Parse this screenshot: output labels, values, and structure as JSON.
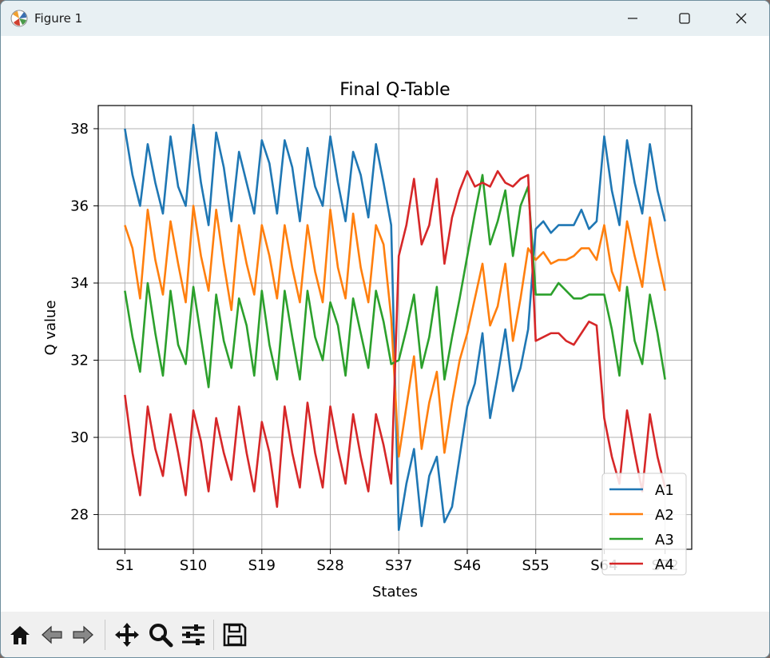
{
  "window": {
    "title": "Figure 1",
    "controls": {
      "minimize": "minimize-icon",
      "maximize": "maximize-icon",
      "close": "close-icon"
    }
  },
  "toolbar": {
    "buttons": [
      "home-icon",
      "back-icon",
      "forward-icon",
      "pan-icon",
      "zoom-icon",
      "configure-subplots-icon",
      "save-icon"
    ]
  },
  "chart_data": {
    "type": "line",
    "title": "Final Q-Table",
    "xlabel": "States",
    "ylabel": "Q value",
    "x_tick_labels": [
      "S1",
      "S10",
      "S19",
      "S28",
      "S37",
      "S46",
      "S55",
      "S64",
      "S72"
    ],
    "x_tick_positions": [
      1,
      10,
      19,
      28,
      37,
      46,
      55,
      64,
      72
    ],
    "y_ticks": [
      28,
      30,
      32,
      34,
      36,
      38
    ],
    "xlim": [
      -2.5,
      75.5
    ],
    "ylim": [
      27.1,
      38.6
    ],
    "grid": true,
    "legend": "lower-right",
    "colors": {
      "A1": "#1f77b4",
      "A2": "#ff7f0e",
      "A3": "#2ca02c",
      "A4": "#d62728"
    },
    "series": [
      {
        "name": "A1",
        "values": [
          38.0,
          36.8,
          36.0,
          37.6,
          36.6,
          35.8,
          37.8,
          36.5,
          36.0,
          38.1,
          36.6,
          35.5,
          37.9,
          37.0,
          35.6,
          37.4,
          36.6,
          35.8,
          37.7,
          37.1,
          35.8,
          37.7,
          37.0,
          35.6,
          37.5,
          36.5,
          36.0,
          37.8,
          36.6,
          35.6,
          37.4,
          36.8,
          35.7,
          37.6,
          36.6,
          35.5,
          27.6,
          28.8,
          29.7,
          27.7,
          29.0,
          29.5,
          27.8,
          28.2,
          29.5,
          30.8,
          31.4,
          32.7,
          30.5,
          31.6,
          32.8,
          31.2,
          31.8,
          32.8,
          35.4,
          35.6,
          35.3,
          35.5,
          35.5,
          35.5,
          35.9,
          35.4,
          35.6,
          37.8,
          36.4,
          35.5,
          37.7,
          36.6,
          35.8,
          37.6,
          36.4,
          35.6
        ]
      },
      {
        "name": "A2",
        "values": [
          35.5,
          34.9,
          33.6,
          35.9,
          34.6,
          33.7,
          35.6,
          34.5,
          33.5,
          36.0,
          34.7,
          33.8,
          35.9,
          34.5,
          33.3,
          35.5,
          34.5,
          33.7,
          35.5,
          34.7,
          33.6,
          35.5,
          34.4,
          33.5,
          35.5,
          34.3,
          33.5,
          35.9,
          34.4,
          33.6,
          35.8,
          34.4,
          33.5,
          35.5,
          35.0,
          33.1,
          29.5,
          30.8,
          32.1,
          29.7,
          30.9,
          31.7,
          29.6,
          30.9,
          32.0,
          32.7,
          33.6,
          34.5,
          32.9,
          33.4,
          34.5,
          32.5,
          33.6,
          34.9,
          34.6,
          34.8,
          34.5,
          34.6,
          34.6,
          34.7,
          34.9,
          34.9,
          34.6,
          35.5,
          34.3,
          33.8,
          35.6,
          34.7,
          33.9,
          35.7,
          34.7,
          33.8
        ]
      },
      {
        "name": "A3",
        "values": [
          33.8,
          32.6,
          31.7,
          34.0,
          32.7,
          31.6,
          33.8,
          32.4,
          31.9,
          33.9,
          32.6,
          31.3,
          33.7,
          32.5,
          31.8,
          33.6,
          32.9,
          31.6,
          33.8,
          32.4,
          31.5,
          33.8,
          32.6,
          31.5,
          33.8,
          32.6,
          32.0,
          33.5,
          32.9,
          31.6,
          33.6,
          32.7,
          31.8,
          33.8,
          33.0,
          31.9,
          32.0,
          32.8,
          33.7,
          31.8,
          32.6,
          33.9,
          31.5,
          32.6,
          33.6,
          34.7,
          35.8,
          36.8,
          35.0,
          35.6,
          36.4,
          34.7,
          36.0,
          36.5,
          33.7,
          33.7,
          33.7,
          34.0,
          33.8,
          33.6,
          33.6,
          33.7,
          33.7,
          33.7,
          32.8,
          31.6,
          33.9,
          32.5,
          31.9,
          33.7,
          32.7,
          31.5
        ]
      },
      {
        "name": "A4",
        "values": [
          31.1,
          29.6,
          28.5,
          30.8,
          29.7,
          29.0,
          30.6,
          29.6,
          28.5,
          30.7,
          29.9,
          28.6,
          30.5,
          29.6,
          28.9,
          30.8,
          29.6,
          28.6,
          30.4,
          29.6,
          28.2,
          30.8,
          29.6,
          28.7,
          30.9,
          29.6,
          28.7,
          30.8,
          29.7,
          28.8,
          30.6,
          29.5,
          28.6,
          30.6,
          29.8,
          28.8,
          34.7,
          35.5,
          36.7,
          35.0,
          35.5,
          36.7,
          34.5,
          35.7,
          36.4,
          36.9,
          36.5,
          36.6,
          36.5,
          36.9,
          36.6,
          36.5,
          36.7,
          36.8,
          32.5,
          32.6,
          32.7,
          32.7,
          32.5,
          32.4,
          32.7,
          33.0,
          32.9,
          30.5,
          29.5,
          28.8,
          30.7,
          29.6,
          28.6,
          30.6,
          29.5,
          28.7
        ]
      }
    ]
  }
}
